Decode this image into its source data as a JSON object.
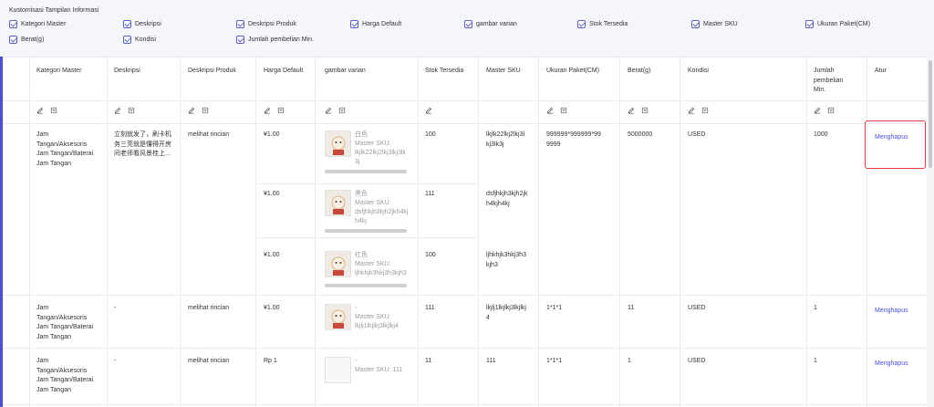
{
  "customization": {
    "title": "Kustomisasi Tampilan Informasi",
    "options": [
      "Kategori Master",
      "Deskripsi",
      "Deskripsi Produk",
      "Harga Default",
      "gambar varian",
      "Stok Tersedia",
      "Master SKU",
      "Ukuran Paket(CM)",
      "Berat(g)",
      "Kondisi",
      "Jumlah pembelian Min."
    ]
  },
  "table": {
    "headers": [
      "Kategori Master",
      "Deskripsi",
      "Deskripsi Produk",
      "Harga Default",
      "gambar varian",
      "Stok Tersedia",
      "Master SKU",
      "Ukuran Paket(CM)",
      "Berat(g)",
      "Kondisi",
      "Jumlah\npembelian\nMin.",
      "Atur"
    ],
    "products": [
      {
        "kategori": "Jam\nTangan/Aksesoris\nJam Tangan/Baterai\nJam Tangan",
        "deskripsi": "立刻就发了，刷卡机\n务三亮就是懂得开房\n间老师看风景桂上...",
        "deskripsi_produk": "melihat rincian",
        "ukuran": "999999*999999*99\n9999",
        "berat": "5000000",
        "kondisi": "USED",
        "jumlah_min": "1000",
        "action": "Menghapus",
        "variants": [
          {
            "harga": "¥1.00",
            "name": "白色",
            "sku_label": "Master SKU:",
            "sku_val": "lkjlk22lkj2lkj3lkj3lk",
            "sku_val2": "3j",
            "stok": "100",
            "master_sku": "lkjlk22lkj2lkj3l\nkj3lk3j"
          },
          {
            "harga": "¥1.00",
            "name": "黑色",
            "sku_label": "Master SKU:",
            "sku_val": "dsfjhkjh3kjh2jkh4kj",
            "sku_val2": "h4kj",
            "stok": "111",
            "master_sku": "dsfjhkjh3kjh2jk\nh4kjh4kj"
          },
          {
            "harga": "¥1.00",
            "name": "红色",
            "sku_label": "Master SKU:",
            "sku_val": "ljhkhjk3hkj3h3kjh3",
            "sku_val2": "",
            "stok": "100",
            "master_sku": "ljhkhjk3hkj3h3\nkjh3"
          }
        ]
      },
      {
        "kategori": "Jam\nTangan/Aksesoris\nJam Tangan/Baterai\nJam Tangan",
        "deskripsi": "-",
        "deskripsi_produk": "melihat rincian",
        "harga": "¥1.00",
        "name": "-",
        "sku_label": "Master SKU:",
        "sku_val": "lkjlj1lkjlkj3lkjlkj4",
        "stok": "111",
        "master_sku": "lkjlj1lkjlkj3lkjlkj\n4",
        "ukuran": "1*1*1",
        "berat": "11",
        "kondisi": "USED",
        "jumlah_min": "1",
        "action": "Menghapus"
      },
      {
        "kategori": "Jam\nTangan/Aksesoris\nJam Tangan/Baterai\nJam Tangan",
        "deskripsi": "-",
        "deskripsi_produk": "melihat rincian",
        "harga": "Rp 1",
        "name": "-",
        "sku_label": "Master SKU: 111",
        "stok": "11",
        "master_sku": "111",
        "ukuran": "1*1*1",
        "berat": "1",
        "kondisi": "USED",
        "jumlah_min": "1",
        "action": "Menghapus"
      }
    ]
  },
  "colors": {
    "accent": "#4a4fd6",
    "highlight": "#e03a3a"
  }
}
